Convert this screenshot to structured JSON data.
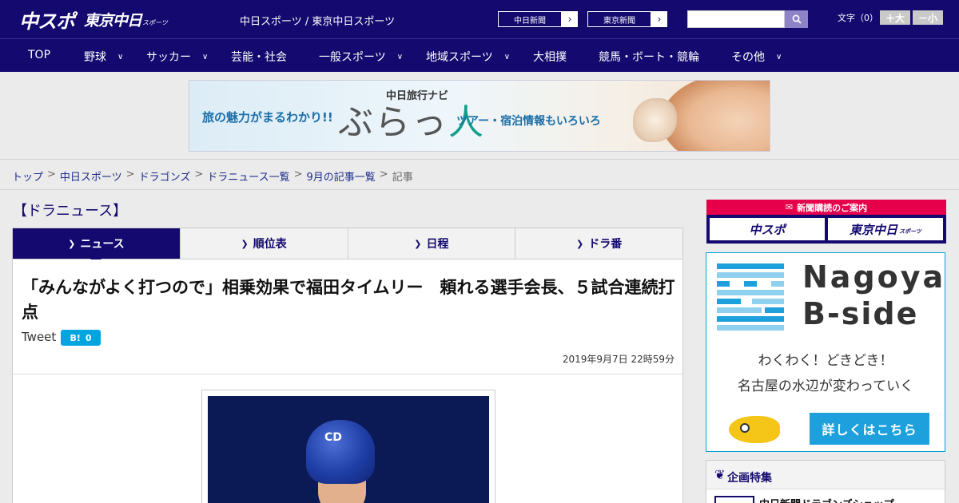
{
  "header": {
    "logo_chuspo": "中スポ",
    "logo_tokyo": "東京中日",
    "logo_small": "スポーツ",
    "site_name": "中日スポーツ / 東京中日スポーツ",
    "papers": [
      {
        "label": "中日新聞"
      },
      {
        "label": "東京新聞"
      }
    ],
    "search_placeholder": "",
    "font_label": "文字（0）",
    "font_up": "＋大",
    "font_down": "－小"
  },
  "nav": [
    {
      "label": "TOP",
      "has_menu": false
    },
    {
      "label": "野球",
      "has_menu": true
    },
    {
      "label": "サッカー",
      "has_menu": true
    },
    {
      "label": "芸能・社会",
      "has_menu": false
    },
    {
      "label": "一般スポーツ",
      "has_menu": true
    },
    {
      "label": "地域スポーツ",
      "has_menu": true
    },
    {
      "label": "大相撲",
      "has_menu": false
    },
    {
      "label": "競馬・ボート・競輪",
      "has_menu": false
    },
    {
      "label": "その他",
      "has_menu": true
    }
  ],
  "ad": {
    "left_text": "旅の魅力がまるわかり!!",
    "navi": "中日旅行ナビ",
    "title_a": "ぶらっ",
    "title_b": "人",
    "right_text": "ツアー・宿泊情報もいろいろ"
  },
  "breadcrumb": [
    {
      "label": "トップ",
      "link": true
    },
    {
      "label": "中日スポーツ",
      "link": true
    },
    {
      "label": "ドラゴンズ",
      "link": true
    },
    {
      "label": "ドラニュース一覧",
      "link": true
    },
    {
      "label": "9月の記事一覧",
      "link": true
    },
    {
      "label": "記事",
      "link": false
    }
  ],
  "section_title": "【ドラニュース】",
  "tabs": [
    {
      "label": "ニュース",
      "active": true
    },
    {
      "label": "順位表",
      "active": false
    },
    {
      "label": "日程",
      "active": false
    },
    {
      "label": "ドラ番",
      "active": false
    }
  ],
  "article": {
    "headline": "「みんながよく打つので」相乗効果で福田タイムリー　頼れる選手会長、５試合連続打点",
    "tweet": "Tweet",
    "hatena_icon": "B!",
    "hatena_count": "0",
    "date": "2019年9月7日 22時59分"
  },
  "photo": {
    "helmet_logo": "CD"
  },
  "sidebar": {
    "subscribe_head": "新聞購読のご案内",
    "subscribe_a": "中スポ",
    "subscribe_b": "東京中日",
    "subscribe_b_small": "スポーツ",
    "bside_title1": "Nagoya",
    "bside_title2": "B-side",
    "bside_t1": "わくわく！どきどき！",
    "bside_t2": "名古屋の水辺が変わっていく",
    "bside_button": "詳しくはこちら",
    "special_title": "企画特集",
    "special_item": "中日新聞ドラゴンズショップ"
  },
  "colors": {
    "brand_navy": "#13096f",
    "accent_red": "#e6004c",
    "accent_blue": "#1ea0dd",
    "hatena_blue": "#00a4de"
  }
}
